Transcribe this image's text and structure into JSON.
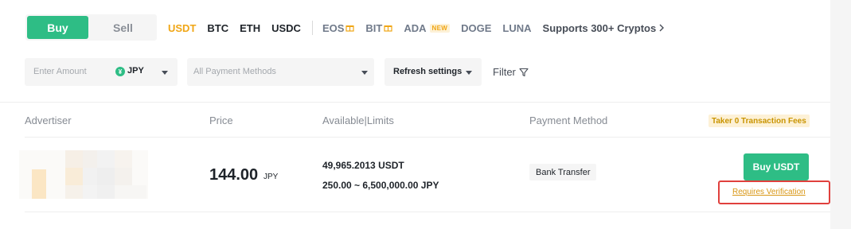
{
  "trade_toggle": {
    "buy": "Buy",
    "sell": "Sell"
  },
  "assets": [
    {
      "label": "USDT",
      "active": true
    },
    {
      "label": "BTC"
    },
    {
      "label": "ETH"
    },
    {
      "label": "USDC"
    },
    {
      "label": "EOS",
      "gift": true
    },
    {
      "label": "BIT",
      "gift": true
    },
    {
      "label": "ADA",
      "badge": "NEW"
    },
    {
      "label": "DOGE"
    },
    {
      "label": "LUNA"
    }
  ],
  "supports_link": "Supports 300+ Cryptos",
  "filters": {
    "amount_placeholder": "Enter Amount",
    "currency": "JPY",
    "payment_placeholder": "All Payment Methods",
    "refresh_label": "Refresh settings",
    "filter_label": "Filter"
  },
  "table": {
    "headers": {
      "advertiser": "Advertiser",
      "price": "Price",
      "available": "Available|Limits",
      "payment": "Payment Method"
    },
    "fees_badge": "Taker 0 Transaction Fees",
    "row": {
      "price": "144.00",
      "price_currency": "JPY",
      "available": "49,965.2013 USDT",
      "limits": "250.00 ~ 6,500,000.00 JPY",
      "payment_method": "Bank Transfer",
      "action": "Buy USDT",
      "verification": "Requires Verification"
    }
  },
  "colors": {
    "buy_green": "#2ebd85",
    "accent_yellow": "#f0a616",
    "highlight_red": "#e0403d"
  }
}
